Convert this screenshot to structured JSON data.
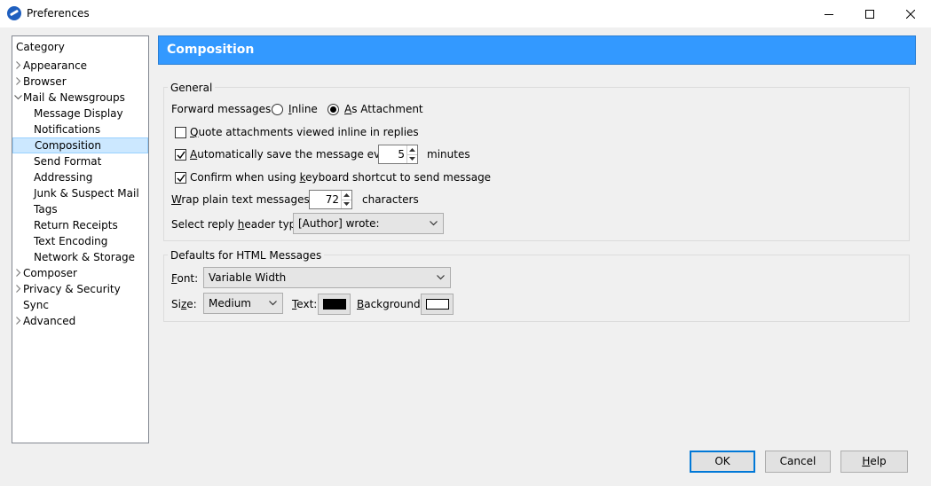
{
  "window": {
    "title": "Preferences"
  },
  "category": {
    "title": "Category",
    "items": [
      {
        "label": "Appearance",
        "indent": 0,
        "chevron": "right"
      },
      {
        "label": "Browser",
        "indent": 0,
        "chevron": "right"
      },
      {
        "label": "Mail & Newsgroups",
        "indent": 0,
        "chevron": "down"
      },
      {
        "label": "Message Display",
        "indent": 1
      },
      {
        "label": "Notifications",
        "indent": 1
      },
      {
        "label": "Composition",
        "indent": 1,
        "selected": true
      },
      {
        "label": "Send Format",
        "indent": 1
      },
      {
        "label": "Addressing",
        "indent": 1
      },
      {
        "label": "Junk & Suspect Mail",
        "indent": 1
      },
      {
        "label": "Tags",
        "indent": 1
      },
      {
        "label": "Return Receipts",
        "indent": 1
      },
      {
        "label": "Text Encoding",
        "indent": 1
      },
      {
        "label": "Network & Storage",
        "indent": 1
      },
      {
        "label": "Composer",
        "indent": 0,
        "chevron": "right"
      },
      {
        "label": "Privacy & Security",
        "indent": 0,
        "chevron": "right"
      },
      {
        "label": "Sync",
        "indent": 0
      },
      {
        "label": "Advanced",
        "indent": 0,
        "chevron": "right"
      }
    ]
  },
  "panel": {
    "title": "Composition"
  },
  "general": {
    "group_label": "General",
    "forward_label": "Forward messages:",
    "forward_inline": {
      "pre": "",
      "key": "I",
      "post": "nline"
    },
    "forward_attachment": {
      "pre": "",
      "key": "A",
      "post": "s Attachment"
    },
    "quote_attachments": {
      "pre": "",
      "key": "Q",
      "post": "uote attachments viewed inline in replies"
    },
    "autosave": {
      "pre": "",
      "key": "A",
      "post": "utomatically save the message every"
    },
    "autosave_value": "5",
    "autosave_unit": "minutes",
    "confirm_shortcut": {
      "pre": "Confirm when using ",
      "key": "k",
      "post": "eyboard shortcut to send message"
    },
    "wrap": {
      "pre": "",
      "key": "W",
      "post": "rap plain text messages at"
    },
    "wrap_value": "72",
    "wrap_unit": "characters",
    "reply_header": {
      "pre": "Select reply ",
      "key": "h",
      "post": "eader type:"
    },
    "reply_header_value": "[Author] wrote:"
  },
  "html_defaults": {
    "group_label": "Defaults for HTML Messages",
    "font": {
      "pre": "",
      "key": "F",
      "post": "ont:"
    },
    "font_value": "Variable Width",
    "size": {
      "pre": "Si",
      "key": "z",
      "post": "e:"
    },
    "size_value": "Medium",
    "text": {
      "pre": "",
      "key": "T",
      "post": "ext:"
    },
    "text_color": "#000000",
    "background": {
      "pre": "",
      "key": "B",
      "post": "ackground:"
    },
    "background_color": "#ffffff"
  },
  "buttons": {
    "ok": "OK",
    "cancel": "Cancel",
    "help": {
      "pre": "",
      "key": "H",
      "post": "elp"
    }
  },
  "colors": {
    "accent": "#3399ff",
    "selection": "#cce8ff"
  }
}
